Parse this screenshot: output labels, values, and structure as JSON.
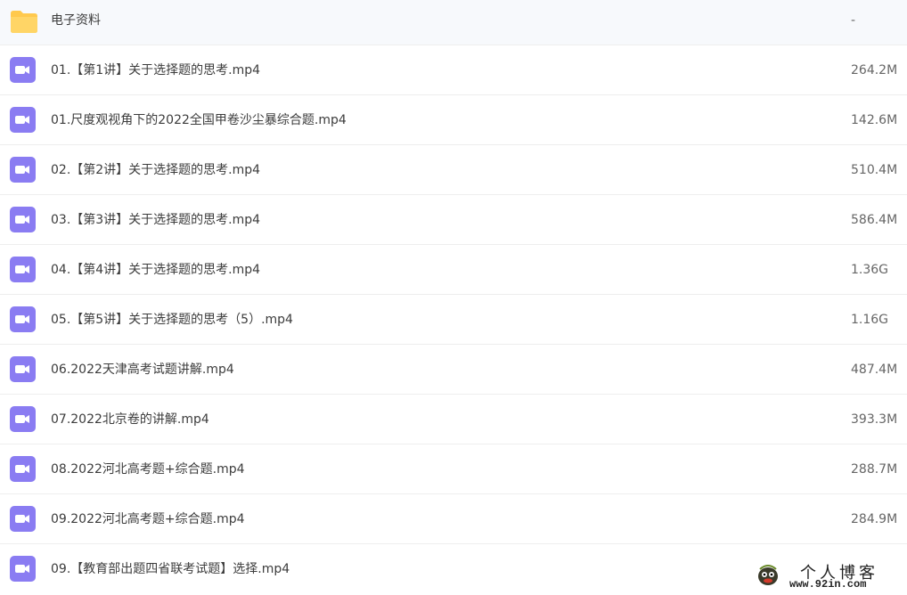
{
  "files": [
    {
      "name": "电子资料",
      "size": "-",
      "type": "folder",
      "icon": "folder-icon"
    },
    {
      "name": "01.【第1讲】关于选择题的思考.mp4",
      "size": "264.2M",
      "type": "video",
      "icon": "video-icon"
    },
    {
      "name": "01.尺度观视角下的2022全国甲卷沙尘暴综合题.mp4",
      "size": "142.6M",
      "type": "video",
      "icon": "video-icon"
    },
    {
      "name": "02.【第2讲】关于选择题的思考.mp4",
      "size": "510.4M",
      "type": "video",
      "icon": "video-icon"
    },
    {
      "name": "03.【第3讲】关于选择题的思考.mp4",
      "size": "586.4M",
      "type": "video",
      "icon": "video-icon"
    },
    {
      "name": "04.【第4讲】关于选择题的思考.mp4",
      "size": "1.36G",
      "type": "video",
      "icon": "video-icon"
    },
    {
      "name": "05.【第5讲】关于选择题的思考（5）.mp4",
      "size": "1.16G",
      "type": "video",
      "icon": "video-icon"
    },
    {
      "name": "06.2022天津高考试题讲解.mp4",
      "size": "487.4M",
      "type": "video",
      "icon": "video-icon"
    },
    {
      "name": "07.2022北京卷的讲解.mp4",
      "size": "393.3M",
      "type": "video",
      "icon": "video-icon"
    },
    {
      "name": "08.2022河北高考题+综合题.mp4",
      "size": "288.7M",
      "type": "video",
      "icon": "video-icon"
    },
    {
      "name": "09.2022河北高考题+综合题.mp4",
      "size": "284.9M",
      "type": "video",
      "icon": "video-icon"
    },
    {
      "name": "09.【教育部出题四省联考试题】选择.mp4",
      "size": "",
      "type": "video",
      "icon": "video-icon"
    }
  ],
  "watermark": {
    "title": "个人博客",
    "url": "www.92in.com",
    "logo": "mascot-logo"
  },
  "colors": {
    "folder": "#FFC94D",
    "video": "#8A7CF2",
    "divider": "#EEEEEE"
  }
}
